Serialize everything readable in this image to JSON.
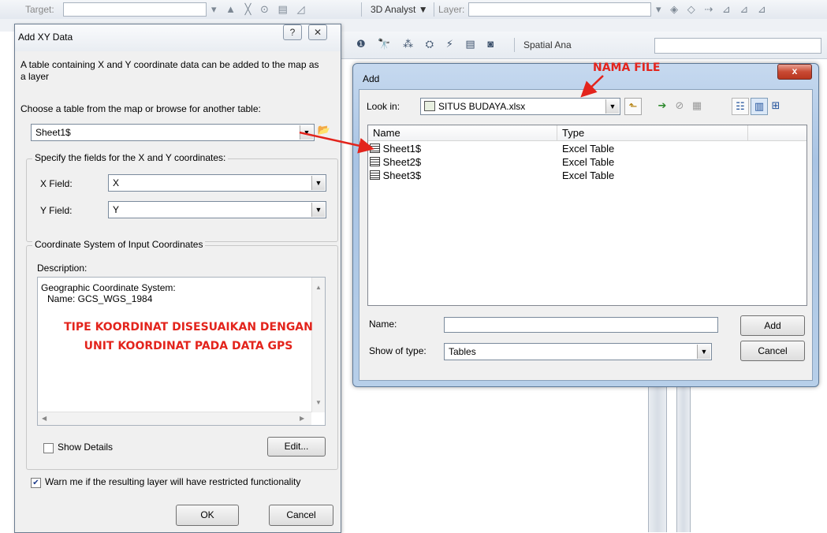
{
  "background_toolbar": {
    "target_label": "Target:",
    "analyst_menu": "3D Analyst ▼",
    "layer_label": "Layer:",
    "spatial_analyst": "Spatial Ana",
    "toolbar_glyphs_left": "▾ ▲ ╳ ⊙ ▤ ◿",
    "toolbar_glyphs_right": "▾ ◈ ◇ ⇢ ⊿ ⊿ ⊿",
    "toolbar2_glyphs": "❶ 🔭 ⁂ ⛭ ⚡ ▤ ◙"
  },
  "add_xy": {
    "title": "Add XY Data",
    "help_btn": "?",
    "close_btn": "✕",
    "intro": "A table containing X and Y coordinate data can be added to the map as a layer",
    "choose_label": "Choose a table from the map or browse for another table:",
    "table_value": "Sheet1$",
    "fields_group": "Specify the fields for the X and Y coordinates:",
    "x_label": "X Field:",
    "x_value": "X",
    "y_label": "Y Field:",
    "y_value": "Y",
    "coord_group": "Coordinate System of Input Coordinates",
    "description_label": "Description:",
    "description_line1": "Geographic Coordinate System:",
    "description_line2": "Name: GCS_WGS_1984",
    "show_details": "Show Details",
    "edit_btn": "Edit...",
    "warn": "Warn me if the resulting layer will have restricted functionality",
    "ok_btn": "OK",
    "cancel_btn": "Cancel"
  },
  "add_dialog": {
    "title": "Add",
    "look_in_label": "Look in:",
    "look_in_value": "SITUS BUDAYA.xlsx",
    "columns": [
      "Name",
      "Type"
    ],
    "rows": [
      {
        "name": "Sheet1$",
        "type": "Excel Table"
      },
      {
        "name": "Sheet2$",
        "type": "Excel Table"
      },
      {
        "name": "Sheet3$",
        "type": "Excel Table"
      }
    ],
    "name_label": "Name:",
    "name_value": "",
    "show_type_label": "Show of type:",
    "show_type_value": "Tables",
    "add_btn": "Add",
    "cancel_btn": "Cancel"
  },
  "annotations": {
    "nama_file": "NAMA FILE",
    "tipe_line1": "TIPE KOORDINAT DISESUAIKAN DENGAN",
    "tipe_line2": "UNIT KOORDINAT PADA DATA GPS",
    "color": "#e3241c"
  }
}
